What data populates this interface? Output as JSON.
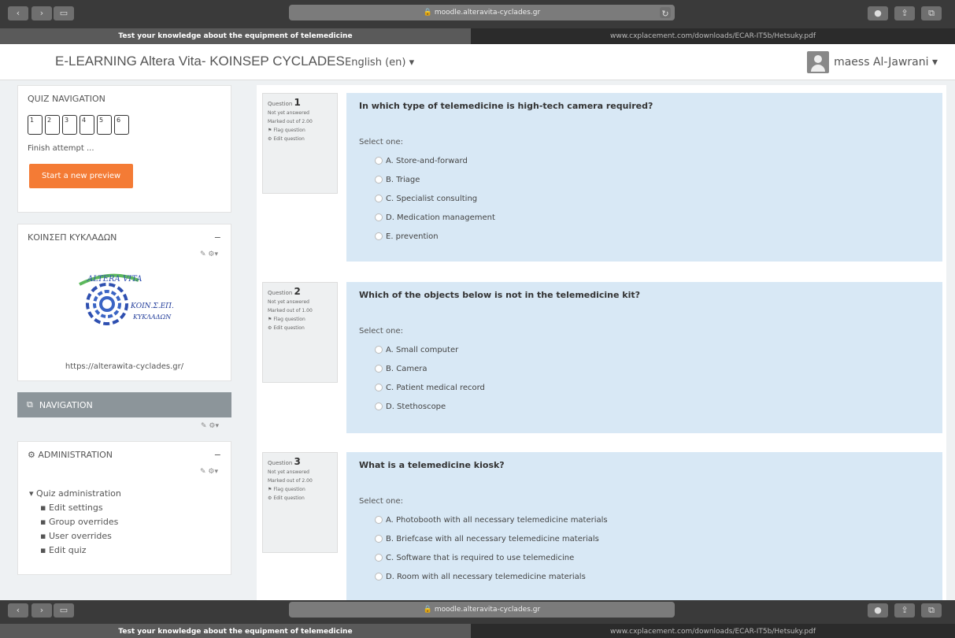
{
  "browser": {
    "url": "moodle.alteravita-cyclades.gr",
    "active_tab": "Test your knowledge about the equipment of telemedicine",
    "inactive_tab": "www.cxplacement.com/downloads/ECAR-IT5b/Hetsuky.pdf"
  },
  "header": {
    "brand": "E-LEARNING Altera Vita- KOINSEP CYCLADES",
    "language": "English (en) ▾",
    "user": "maess Al-Jawrani ▾"
  },
  "sidebar": {
    "quiz_nav_title": "QUIZ NAVIGATION",
    "question_buttons": [
      "1",
      "2",
      "3",
      "4",
      "5",
      "6"
    ],
    "finish_attempt": "Finish attempt ...",
    "new_preview": "Start a new preview",
    "koinsep_title": "ΚΟΙΝΣΕΠ ΚΥΚΛΑΔΩΝ",
    "logo_link": "https://alterawita-cyclades.gr/",
    "navigation_title": "NAVIGATION",
    "administration_title": "ADMINISTRATION",
    "admin_items": [
      "Quiz administration",
      "Edit settings",
      "Group overrides",
      "User overrides",
      "Edit quiz"
    ]
  },
  "questions": [
    {
      "label": "Question",
      "number": "1",
      "status": "Not yet answered",
      "marked": "Marked out of 2.00",
      "flag": "Flag question",
      "edit": "Edit question",
      "text": "In which type of telemedicine is high-tech camera required?",
      "select": "Select one:",
      "answers": [
        "A. Store-and-forward",
        "B. Triage",
        "C. Specialist consulting",
        "D. Medication management",
        "E. prevention"
      ]
    },
    {
      "label": "Question",
      "number": "2",
      "status": "Not yet answered",
      "marked": "Marked out of 1.00",
      "flag": "Flag question",
      "edit": "Edit question",
      "text": "Which of the objects below is not in the telemedicine kit?",
      "select": "Select one:",
      "answers": [
        "A. Small computer",
        "B. Camera",
        "C. Patient medical record",
        "D. Stethoscope"
      ]
    },
    {
      "label": "Question",
      "number": "3",
      "status": "Not yet answered",
      "marked": "Marked out of 2.00",
      "flag": "Flag question",
      "edit": "Edit question",
      "text": "What is a telemedicine kiosk?",
      "select": "Select one:",
      "answers": [
        "A. Photobooth with all necessary telemedicine materials",
        "B. Briefcase with all necessary telemedicine materials",
        "C. Software that is required to use telemedicine",
        "D. Room with all necessary telemedicine materials"
      ]
    }
  ]
}
